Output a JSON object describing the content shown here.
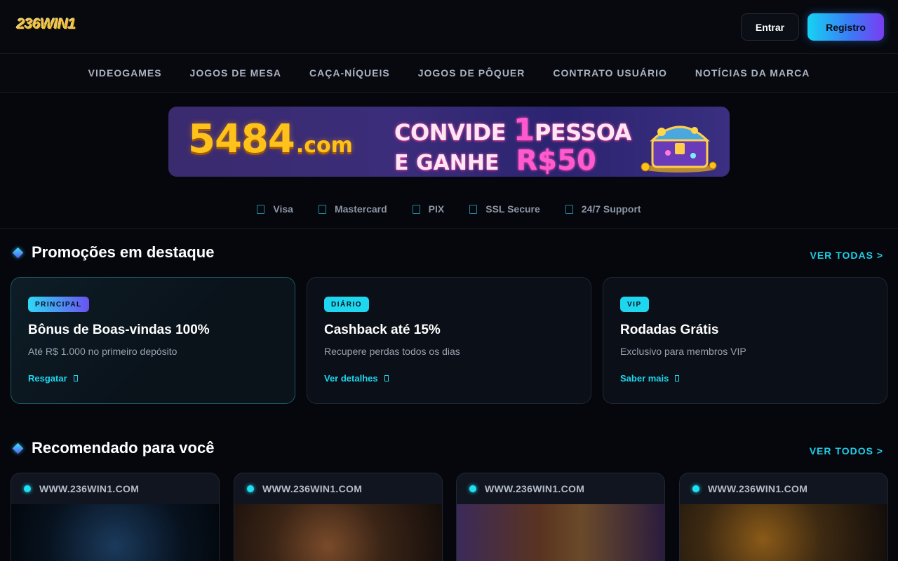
{
  "header": {
    "logo_text": "236WIN1",
    "login_label": "Entrar",
    "register_label": "Registro"
  },
  "nav": {
    "items": [
      "VIDEOGAMES",
      "JOGOS DE MESA",
      "CAÇA-NÍQUEIS",
      "JOGOS DE PÔQUER",
      "CONTRATO USUÁRIO",
      "NOTÍCIAS DA MARCA"
    ]
  },
  "banner": {
    "brand_number": "5484",
    "brand_domain": ".com",
    "line1_a": "CONVIDE",
    "line1_number": "1",
    "line1_b": "PESSOA",
    "line2_a": "E GANHE",
    "line2_money": "R$50"
  },
  "payments": [
    {
      "label": "Visa",
      "icon": "card-icon"
    },
    {
      "label": "Mastercard",
      "icon": "card-icon"
    },
    {
      "label": "PIX",
      "icon": "pix-icon"
    },
    {
      "label": "SSL Secure",
      "icon": "lock-icon"
    },
    {
      "label": "24/7 Support",
      "icon": "support-icon"
    }
  ],
  "promotions": {
    "title": "Promoções em destaque",
    "see_all": "VER TODAS >",
    "cards": [
      {
        "tag": "PRINCIPAL",
        "title": "Bônus de Boas-vindas 100%",
        "subtitle": "Até R$ 1.000 no primeiro depósito",
        "link": "Resgatar"
      },
      {
        "tag": "DIÁRIO",
        "title": "Cashback até 15%",
        "subtitle": "Recupere perdas todos os dias",
        "link": "Ver detalhes"
      },
      {
        "tag": "VIP",
        "title": "Rodadas Grátis",
        "subtitle": "Exclusivo para membros VIP",
        "link": "Saber mais"
      }
    ]
  },
  "recommended": {
    "title": "Recomendado para você",
    "see_all": "VER TODOS >",
    "cards": [
      {
        "site": "WWW.236WIN1.COM"
      },
      {
        "site": "WWW.236WIN1.COM"
      },
      {
        "site": "WWW.236WIN1.COM"
      },
      {
        "site": "WWW.236WIN1.COM"
      }
    ]
  },
  "colors": {
    "background": "#05070c",
    "accent_cyan": "#1ecfea",
    "accent_purple": "#7a3cf2",
    "banner_gold": "#ffc21a",
    "banner_pink": "#ff5ad0"
  }
}
